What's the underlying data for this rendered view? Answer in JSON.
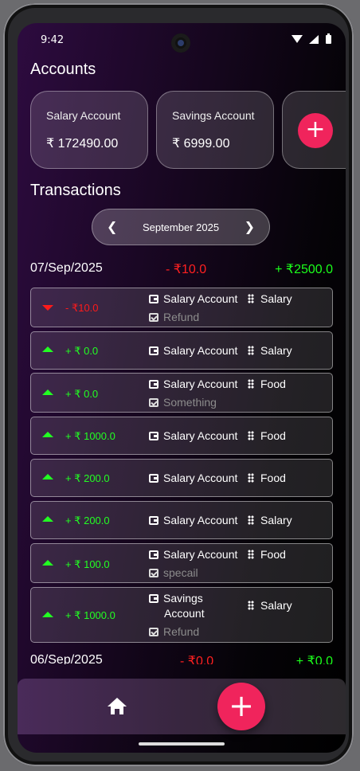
{
  "status_bar": {
    "time": "9:42"
  },
  "accounts": {
    "title": "Accounts",
    "cards": [
      {
        "name": "Salary Account",
        "balance": "₹ 172490.00"
      },
      {
        "name": "Savings Account",
        "balance": "₹ 6999.00"
      }
    ],
    "add_icon": "plus-icon"
  },
  "transactions": {
    "title": "Transactions",
    "month": "September 2025",
    "prev_icon": "chevron-left-icon",
    "next_icon": "chevron-right-icon",
    "days": [
      {
        "date": "07/Sep/2025",
        "expense": "-  ₹10.0",
        "income": "+  ₹2500.0",
        "items": [
          {
            "direction": "down",
            "amount": "- ₹10.0",
            "account": "Salary Account",
            "category": "Salary",
            "note": "Refund"
          },
          {
            "direction": "up",
            "amount": "+ ₹ 0.0",
            "account": "Salary Account",
            "category": "Salary",
            "note": ""
          },
          {
            "direction": "up",
            "amount": "+ ₹ 0.0",
            "account": "Salary Account",
            "category": "Food",
            "note": "Something"
          },
          {
            "direction": "up",
            "amount": "+ ₹ 1000.0",
            "account": "Salary Account",
            "category": "Food",
            "note": ""
          },
          {
            "direction": "up",
            "amount": "+ ₹ 200.0",
            "account": "Salary Account",
            "category": "Food",
            "note": ""
          },
          {
            "direction": "up",
            "amount": "+ ₹ 200.0",
            "account": "Salary Account",
            "category": "Salary",
            "note": ""
          },
          {
            "direction": "up",
            "amount": "+ ₹ 100.0",
            "account": "Salary Account",
            "category": "Food",
            "note": "specail"
          },
          {
            "direction": "up",
            "amount": "+ ₹ 1000.0",
            "account_line1": "Savings",
            "account_line2": "Account",
            "category": "Salary",
            "note": "Refund"
          }
        ]
      },
      {
        "date": "06/Sep/2025",
        "expense": "-  ₹0.0",
        "income": "+  ₹0.0"
      }
    ]
  },
  "bottom_nav": {
    "home_icon": "home-icon",
    "fab_icon": "plus-icon"
  },
  "colors": {
    "accent": "#f0245c",
    "income": "#22ff22",
    "expense": "#ff1a1a"
  }
}
